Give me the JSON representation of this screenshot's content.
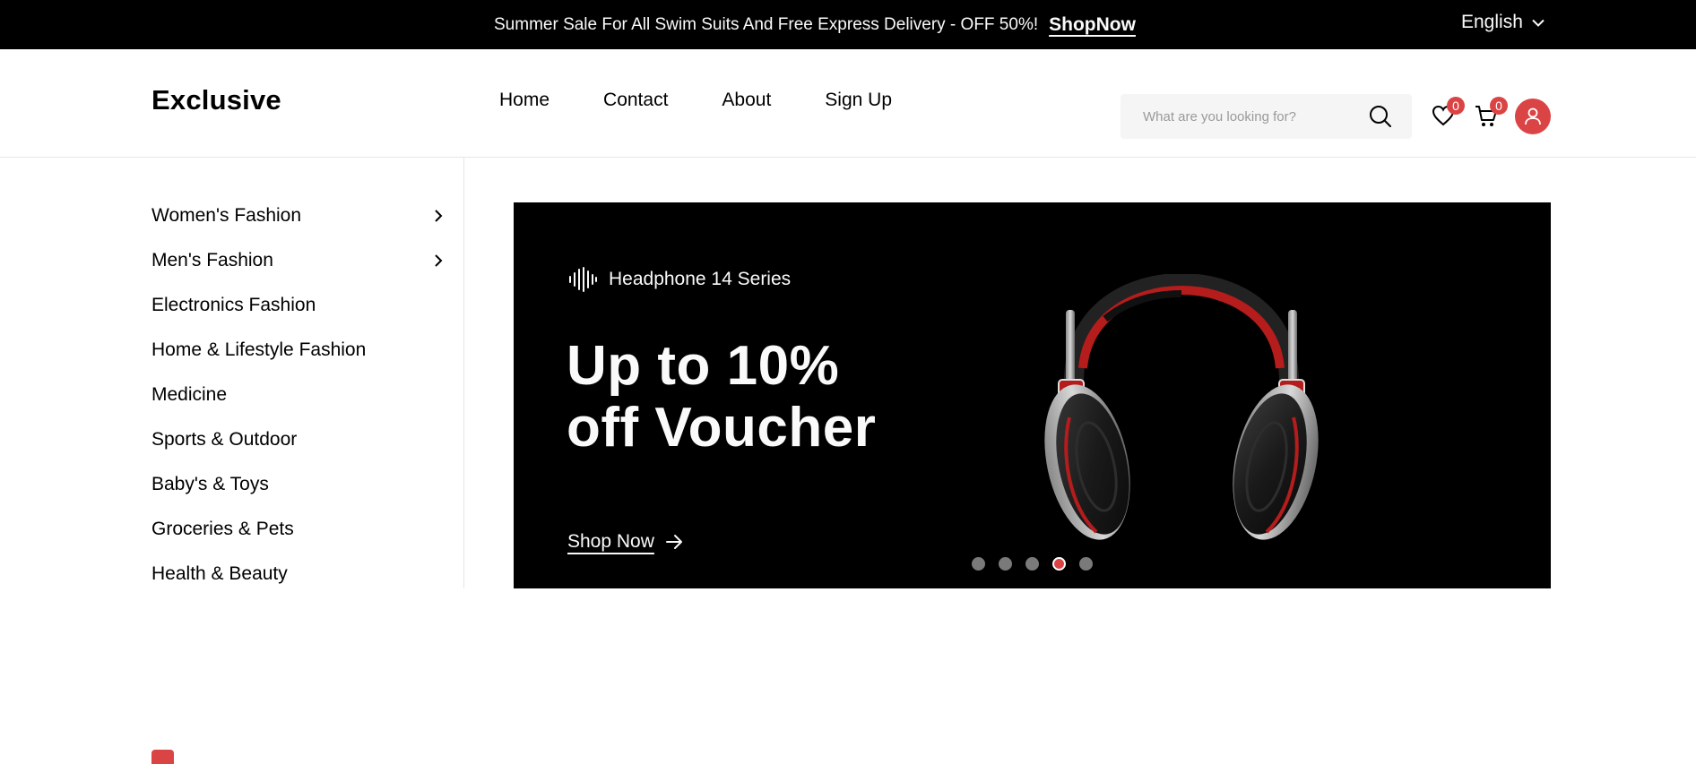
{
  "topbar": {
    "promo_text": "Summer Sale For All Swim Suits And Free Express Delivery - OFF 50%!",
    "promo_link": "ShopNow",
    "language": "English"
  },
  "header": {
    "logo": "Exclusive",
    "nav": [
      "Home",
      "Contact",
      "About",
      "Sign Up"
    ],
    "search_placeholder": "What are you looking for?",
    "wishlist_count": "0",
    "cart_count": "0"
  },
  "sidebar": {
    "items": [
      {
        "label": "Women's Fashion",
        "has_submenu": true
      },
      {
        "label": "Men's Fashion",
        "has_submenu": true
      },
      {
        "label": "Electronics Fashion",
        "has_submenu": false
      },
      {
        "label": "Home & Lifestyle Fashion",
        "has_submenu": false
      },
      {
        "label": "Medicine",
        "has_submenu": false
      },
      {
        "label": "Sports & Outdoor",
        "has_submenu": false
      },
      {
        "label": "Baby's & Toys",
        "has_submenu": false
      },
      {
        "label": "Groceries & Pets",
        "has_submenu": false
      },
      {
        "label": "Health & Beauty",
        "has_submenu": false
      }
    ]
  },
  "hero": {
    "series": "Headphone 14 Series",
    "headline_line1": "Up to 10%",
    "headline_line2": "off Voucher",
    "cta": "Shop Now",
    "active_slide": 4,
    "slide_count": 5
  },
  "colors": {
    "accent": "#db4444",
    "topbar_bg": "#000000",
    "hero_bg": "#000000",
    "search_bg": "#f5f5f5"
  },
  "icons": [
    "chevron-down-icon",
    "search-icon",
    "heart-icon",
    "cart-icon",
    "user-icon",
    "chevron-right-icon",
    "sound-wave-icon",
    "arrow-right-icon"
  ]
}
